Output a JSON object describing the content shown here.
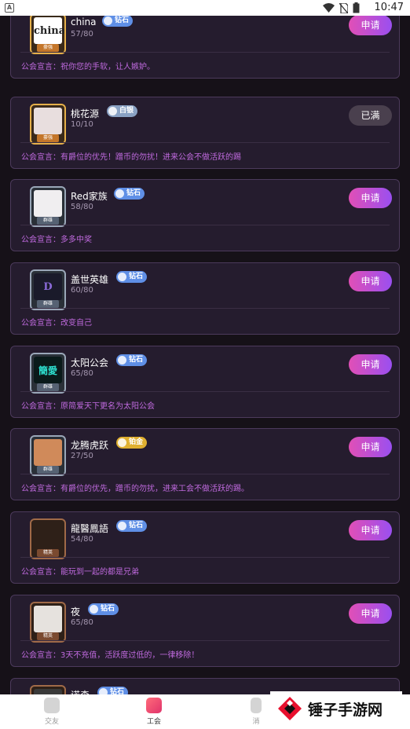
{
  "status_bar": {
    "app_letter": "A",
    "time": "10:47"
  },
  "guilds": [
    {
      "name": "china",
      "badge": "钻石",
      "badge_type": "diamond",
      "count": "57/80",
      "button": "申请",
      "button_type": "apply",
      "declaration_label": "公会宣言：",
      "declaration": "祝你您的手软，让人嫉妒。",
      "rank": "豪强",
      "frame": "gold",
      "avatar_text": "china",
      "avatar_color": "#ffffff"
    },
    {
      "name": "桃花源",
      "badge": "白银",
      "badge_type": "silver",
      "count": "10/10",
      "button": "已满",
      "button_type": "full",
      "declaration_label": "公会宣言：",
      "declaration": "有爵位的优先！蹭币的勿扰！进来公会不做活跃的踢",
      "rank": "豪强",
      "frame": "gold",
      "avatar_text": "",
      "avatar_color": "#e8dede"
    },
    {
      "name": "Red家族",
      "badge": "钻石",
      "badge_type": "diamond",
      "count": "58/80",
      "button": "申请",
      "button_type": "apply",
      "declaration_label": "公会宣言：",
      "declaration": "多多中奖",
      "rank": "群雄",
      "frame": "silver",
      "avatar_text": "",
      "avatar_color": "#f0eef0"
    },
    {
      "name": "盖世英雄",
      "badge": "钻石",
      "badge_type": "diamond",
      "count": "60/80",
      "button": "申请",
      "button_type": "apply",
      "declaration_label": "公会宣言：",
      "declaration": "改变自己",
      "rank": "群雄",
      "frame": "silver",
      "avatar_text": "D",
      "avatar_color": "#1a1a2a"
    },
    {
      "name": "太阳公会",
      "badge": "钻石",
      "badge_type": "diamond",
      "count": "65/80",
      "button": "申请",
      "button_type": "apply",
      "declaration_label": "公会宣言：",
      "declaration": "原简爱天下更名为太阳公会",
      "rank": "群雄",
      "frame": "silver",
      "avatar_text": "簡愛",
      "avatar_color": "#0a1a1a"
    },
    {
      "name": "龙腾虎跃",
      "badge": "铂金",
      "badge_type": "gold",
      "count": "27/50",
      "button": "申请",
      "button_type": "apply",
      "declaration_label": "公会宣言：",
      "declaration": "有爵位的优先，蹭币的勿扰，进来工会不做活跃的踢。",
      "rank": "群雄",
      "frame": "silver",
      "avatar_text": "",
      "avatar_color": "#d08a5a"
    },
    {
      "name": "龍醫鳳語",
      "badge": "钻石",
      "badge_type": "diamond",
      "count": "54/80",
      "button": "申请",
      "button_type": "apply",
      "declaration_label": "公会宣言：",
      "declaration": "能玩到一起的都是兄弟",
      "rank": "精英",
      "frame": "bronze",
      "avatar_text": "",
      "avatar_color": "#2e2018"
    },
    {
      "name": "夜",
      "badge": "钻石",
      "badge_type": "diamond",
      "count": "65/80",
      "button": "申请",
      "button_type": "apply",
      "declaration_label": "公会宣言：",
      "declaration": "3天不充值，活跃度过低的，一律移除！",
      "rank": "精英",
      "frame": "bronze",
      "avatar_text": "",
      "avatar_color": "#e6e2de"
    },
    {
      "name": "诺森",
      "badge": "钻石",
      "badge_type": "diamond",
      "count": "",
      "button": "",
      "button_type": "apply",
      "declaration_label": "",
      "declaration": "",
      "rank": "",
      "frame": "bronze",
      "avatar_text": "",
      "avatar_color": "#3a3a3a"
    }
  ],
  "tabbar": {
    "tab_social": "交友",
    "tab_guild": "工会",
    "tab_partial": "消"
  },
  "watermark": {
    "text": "锤子手游网"
  },
  "colors": {
    "apply_start": "#e14fb6",
    "apply_end": "#9a4ff0",
    "declaration": "#c06adf",
    "card_bg": "#251c2e"
  }
}
